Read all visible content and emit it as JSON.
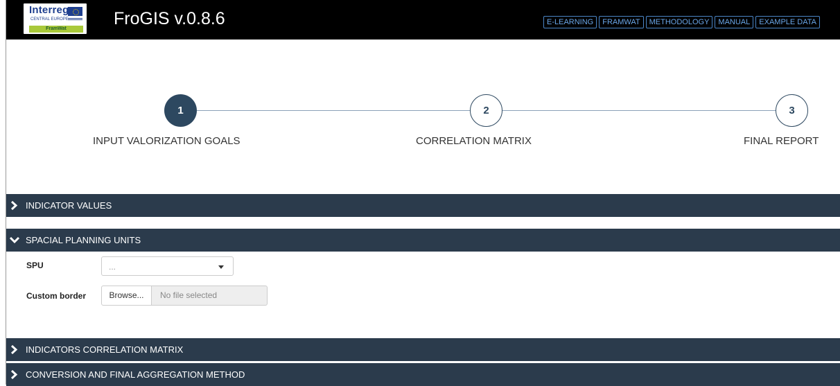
{
  "header": {
    "logo": {
      "word": "Interreg",
      "sub": "CENTRAL EUROPE",
      "tag": "FramWat"
    },
    "title": "FroGIS v.0.8.6",
    "links": [
      "E-LEARNING",
      "FRAMWAT",
      "METHODOLOGY",
      "MANUAL",
      "EXAMPLE DATA"
    ]
  },
  "stepper": {
    "steps": [
      {
        "number": "1",
        "label": "INPUT VALORIZATION GOALS",
        "active": true
      },
      {
        "number": "2",
        "label": "CORRELATION MATRIX",
        "active": false
      },
      {
        "number": "3",
        "label": "FINAL REPORT",
        "active": false
      }
    ]
  },
  "sections": {
    "indicator_values": {
      "label": "INDICATOR VALUES",
      "expanded": false
    },
    "spatial_units": {
      "label": "SPACIAL PLANNING UNITS",
      "expanded": true
    },
    "correlation": {
      "label": "INDICATORS CORRELATION MATRIX",
      "expanded": false
    },
    "conversion": {
      "label": "CONVERSION AND FINAL AGGREGATION METHOD",
      "expanded": false
    }
  },
  "form": {
    "spu_label": "SPU",
    "spu_value": "...",
    "border_label": "Custom border",
    "browse_label": "Browse...",
    "file_status": "No file selected"
  },
  "colors": {
    "header_bg": "#000000",
    "section_bg": "#2b3b4c",
    "accent": "#2d4860",
    "link": "#6aa6e8"
  }
}
